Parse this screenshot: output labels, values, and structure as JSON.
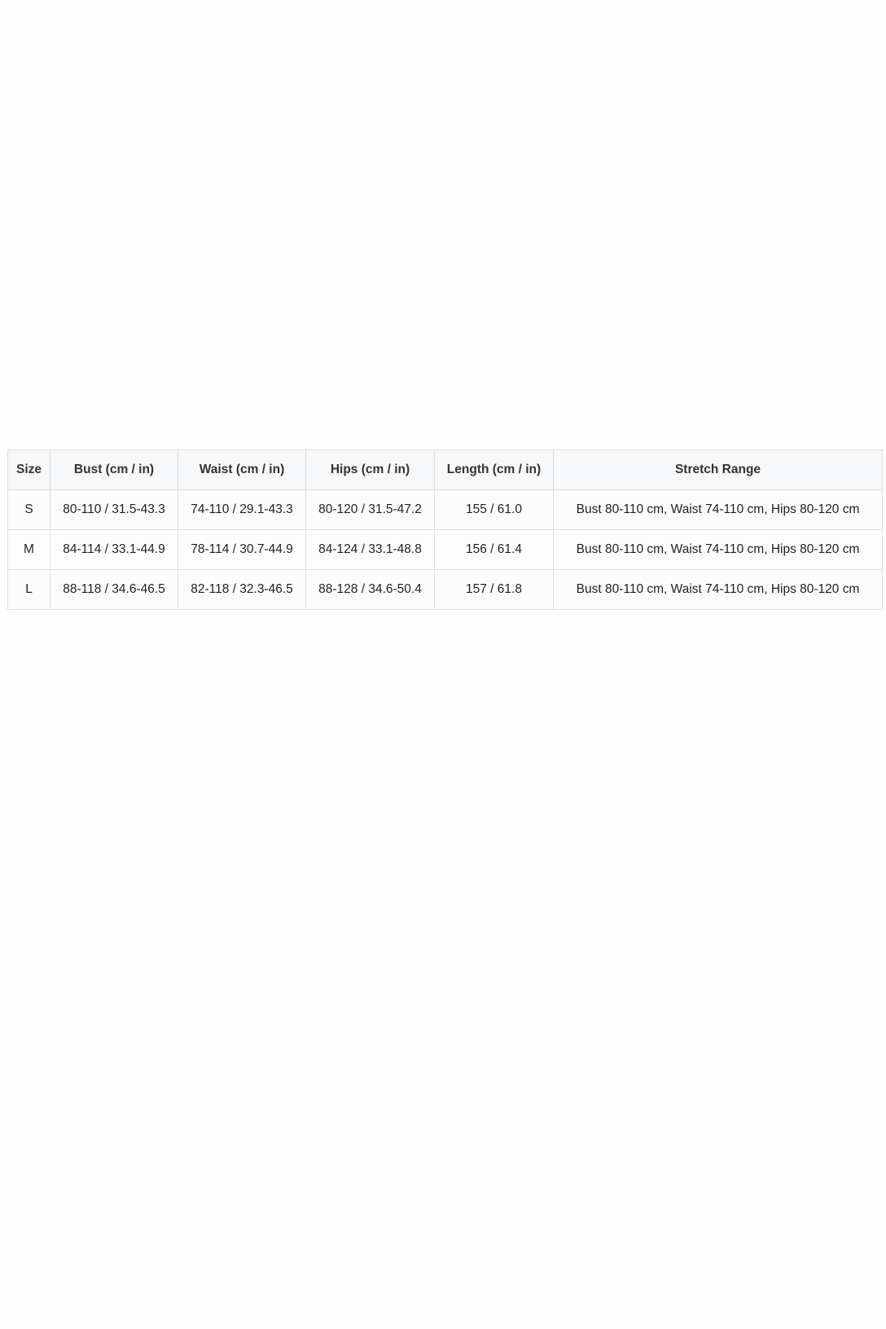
{
  "size_chart": {
    "headers": [
      "Size",
      "Bust (cm / in)",
      "Waist (cm / in)",
      "Hips (cm / in)",
      "Length (cm / in)",
      "Stretch Range"
    ],
    "rows": [
      [
        "S",
        "80-110 / 31.5-43.3",
        "74-110 / 29.1-43.3",
        "80-120 / 31.5-47.2",
        "155 / 61.0",
        "Bust 80-110 cm, Waist 74-110 cm, Hips 80-120 cm"
      ],
      [
        "M",
        "84-114 / 33.1-44.9",
        "78-114 / 30.7-44.9",
        "84-124 / 33.1-48.8",
        "156 / 61.4",
        "Bust 80-110 cm, Waist 74-110 cm, Hips 80-120 cm"
      ],
      [
        "L",
        "88-118 / 34.6-46.5",
        "82-118 / 32.3-46.5",
        "88-128 / 34.6-50.4",
        "157 / 61.8",
        "Bust 80-110 cm, Waist 74-110 cm, Hips 80-120 cm"
      ]
    ]
  },
  "colors": {
    "header_bg": "#f7f8fa",
    "border": "#dedede",
    "text": "#222222"
  }
}
